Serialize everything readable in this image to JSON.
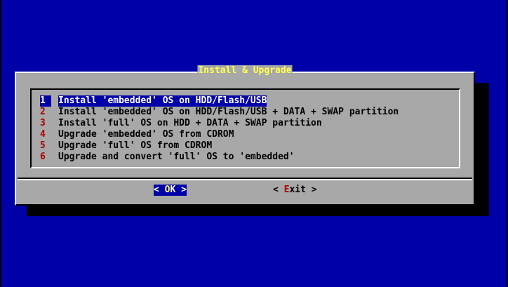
{
  "dialog": {
    "title": "Install & Upgrade"
  },
  "menu": {
    "selected_index": 0,
    "items": [
      {
        "tag": "1",
        "label": "Install 'embedded' OS on HDD/Flash/USB"
      },
      {
        "tag": "2",
        "label": "Install 'embedded' OS on HDD/Flash/USB + DATA + SWAP partition"
      },
      {
        "tag": "3",
        "label": "Install 'full' OS on HDD + DATA + SWAP partition"
      },
      {
        "tag": "4",
        "label": "Upgrade 'embedded' OS from CDROM"
      },
      {
        "tag": "5",
        "label": "Upgrade 'full' OS from CDROM"
      },
      {
        "tag": "6",
        "label": "Upgrade and convert 'full' OS to 'embedded'"
      }
    ]
  },
  "buttons": {
    "ok": {
      "open": "< ",
      "hotkey": "O",
      "rest": "K",
      "close": " >"
    },
    "exit": {
      "open": "< ",
      "hotkey": "E",
      "rest": "xit",
      "close": " >"
    }
  },
  "colors": {
    "screen_background": "#0000a8",
    "dialog_background": "#a8a8a8",
    "title": "#ffff55",
    "highlight": "#0000a8",
    "tag_hotkey": "#a80000"
  }
}
